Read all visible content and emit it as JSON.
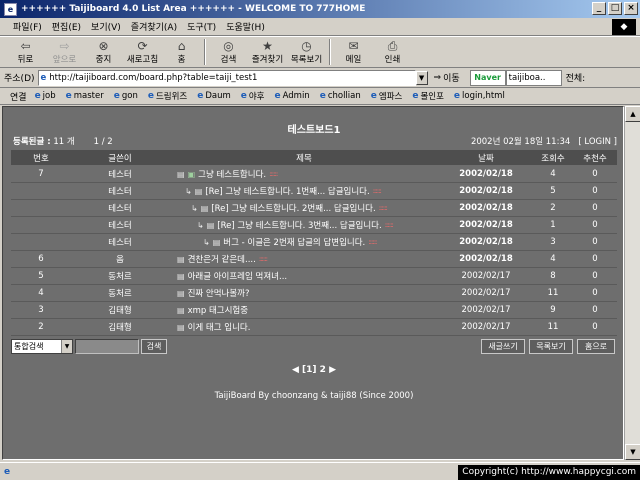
{
  "window": {
    "title": "++++++ Taijiboard 4.0 List Area ++++++ - WELCOME TO 777HOME",
    "min": "_",
    "max": "□",
    "close": "×"
  },
  "menu": [
    "파일(F)",
    "편집(E)",
    "보기(V)",
    "즐겨찾기(A)",
    "도구(T)",
    "도움말(H)"
  ],
  "toolbar": {
    "back": "뒤로",
    "forward": "앞으로",
    "stop": "중지",
    "refresh": "새로고침",
    "home": "홈",
    "search": "검색",
    "favorites": "즐겨찾기",
    "history": "목록보기",
    "mail": "메일",
    "print": "인쇄"
  },
  "address": {
    "label": "주소(D)",
    "url": "http://taijiboard.com/board.php?table=taiji_test1",
    "go": "이동",
    "naver": "Naver",
    "naver_query": "taijiboa..",
    "naver_ext": "전체:"
  },
  "links": {
    "label": "연결",
    "items": [
      "job",
      "master",
      "gon",
      "드림위즈",
      "Daum",
      "야후",
      "Admin",
      "chollian",
      "엠파스",
      "몰인포",
      "login,html"
    ]
  },
  "board": {
    "title": "테스트보드1",
    "count_label": "등록된글 :",
    "count_value": "11 개",
    "page": "1 / 2",
    "datetime": "2002년 02월 18일 11:34",
    "login": "[ LOGIN ]",
    "headers": {
      "no": "번호",
      "author": "글쓴이",
      "subject": "제목",
      "date": "날짜",
      "views": "조회수",
      "recommend": "추천수"
    },
    "rows": [
      {
        "no": "7",
        "author": "테스터",
        "subject": "그냥 테스트합니다.",
        "date": "2002/02/18",
        "views": "4",
        "recommend": "0"
      },
      {
        "no": "",
        "author": "테스터",
        "subject": "[Re] 그냥 테스트합니다. 1번째... 답글입니다.",
        "date": "2002/02/18",
        "views": "5",
        "recommend": "0"
      },
      {
        "no": "",
        "author": "테스터",
        "subject": "[Re] 그냥 테스트합니다. 2번째... 답글입니다.",
        "date": "2002/02/18",
        "views": "2",
        "recommend": "0"
      },
      {
        "no": "",
        "author": "테스터",
        "subject": "[Re] 그냥 테스트합니다. 3번째... 답글입니다.",
        "date": "2002/02/18",
        "views": "1",
        "recommend": "0"
      },
      {
        "no": "",
        "author": "테스터",
        "subject": "버그 - 이글은 2번재 답글의 답변입니다.",
        "date": "2002/02/18",
        "views": "3",
        "recommend": "0"
      },
      {
        "no": "6",
        "author": "옴",
        "subject": "견찬은거 같은데....",
        "date": "2002/02/18",
        "views": "4",
        "recommend": "0"
      },
      {
        "no": "5",
        "author": "동처르",
        "subject": "아래글 아이프레임 먹져녀...",
        "date": "2002/02/17",
        "views": "8",
        "recommend": "0"
      },
      {
        "no": "4",
        "author": "동처르",
        "subject": "진짜 안먹나볼까?",
        "date": "2002/02/17",
        "views": "11",
        "recommend": "0"
      },
      {
        "no": "3",
        "author": "김태형",
        "subject": "xmp 태그시험중",
        "date": "2002/02/17",
        "views": "9",
        "recommend": "0"
      },
      {
        "no": "2",
        "author": "김태형",
        "subject": "이게 태그 입니다.",
        "date": "2002/02/17",
        "views": "11",
        "recommend": "0"
      }
    ],
    "search_select": "통합검색",
    "search_button": "검색",
    "write_button": "새글쓰기",
    "list_button": "목록보기",
    "home_button": "홈으로",
    "pager": "◀ [1] 2 ▶",
    "footer": "TaijiBoard By choonzang & taiji88 (Since 2000)"
  },
  "status": {
    "copyright": "Copyright(c) http://www.happycgi.com"
  }
}
